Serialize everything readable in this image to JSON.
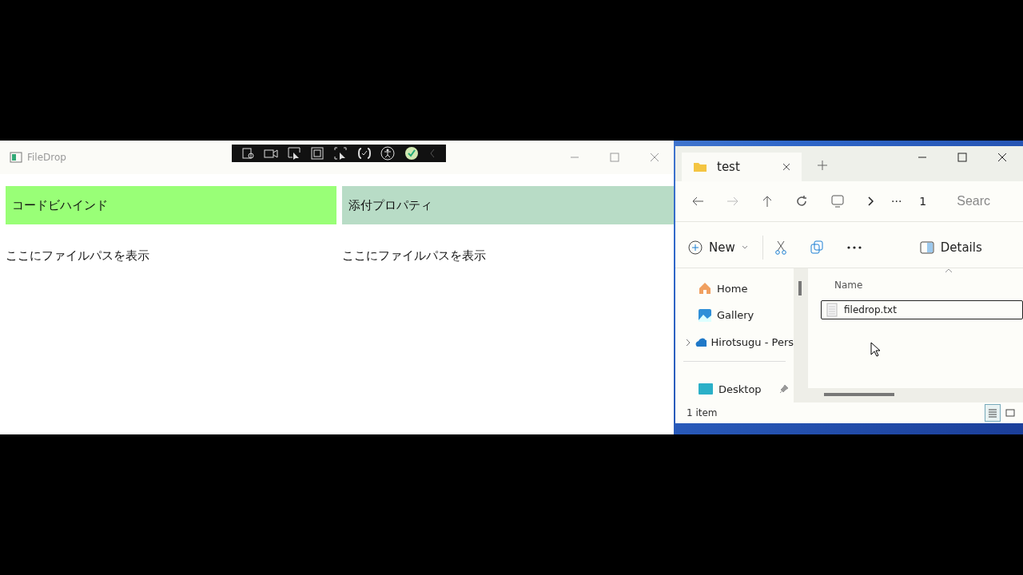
{
  "app_window": {
    "title": "FileDrop",
    "panels": [
      {
        "button": "コードビハインド",
        "color": "#99ff77",
        "path_text": "ここにファイルパスを表示"
      },
      {
        "button": "添付プロパティ",
        "color": "#b8dcc6",
        "path_text": "ここにファイルパスを表示"
      }
    ]
  },
  "explorer": {
    "tab": {
      "title": "test"
    },
    "address": {
      "ellipsis": "···",
      "crumb": "1"
    },
    "search": {
      "placeholder": "Searc"
    },
    "commands": {
      "new": "New",
      "details": "Details"
    },
    "sidebar": [
      {
        "label": "Home",
        "kind": "home",
        "expandable": false,
        "pinned": false
      },
      {
        "label": "Gallery",
        "kind": "gallery",
        "expandable": false,
        "pinned": false
      },
      {
        "label": "Hirotsugu - Pers",
        "kind": "cloud",
        "expandable": true,
        "pinned": false
      },
      {
        "label": "Desktop",
        "kind": "desktop",
        "expandable": false,
        "pinned": true
      }
    ],
    "column": "Name",
    "files": [
      {
        "name": "filedrop.txt",
        "selected": true
      }
    ],
    "status": "1 item",
    "views": [
      {
        "kind": "details",
        "selected": true
      },
      {
        "kind": "tiles",
        "selected": false
      }
    ]
  }
}
